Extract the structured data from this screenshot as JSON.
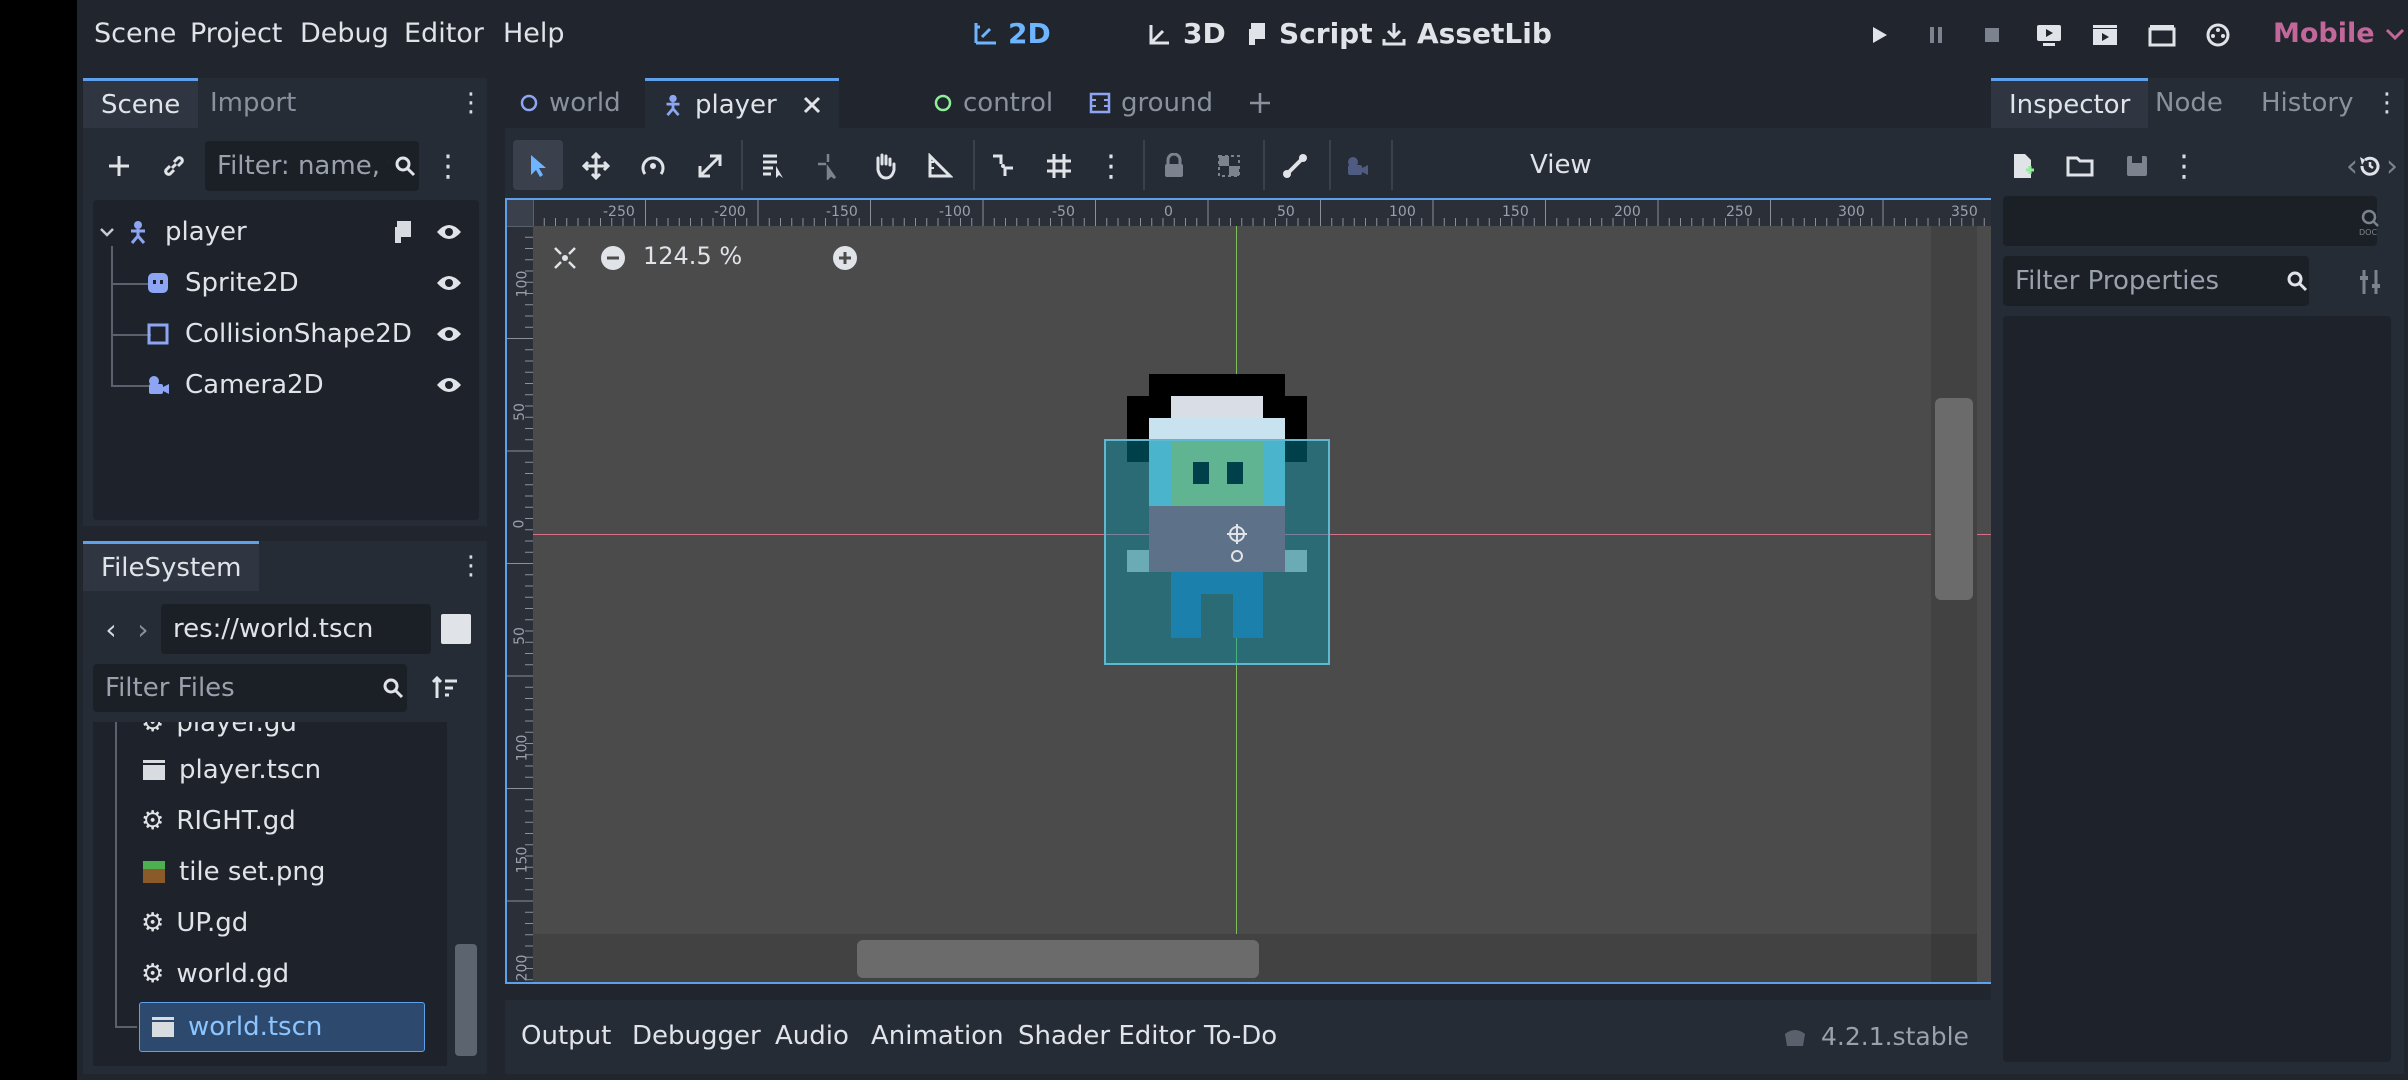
{
  "menubar": {
    "items": [
      "Scene",
      "Project",
      "Debug",
      "Editor",
      "Help"
    ],
    "workspaces": [
      {
        "label": "2D",
        "icon": "2d-icon",
        "active": true
      },
      {
        "label": "3D",
        "icon": "3d-icon",
        "active": false
      },
      {
        "label": "Script",
        "icon": "script-icon",
        "active": false
      },
      {
        "label": "AssetLib",
        "icon": "download-icon",
        "active": false
      }
    ],
    "renderer": "Mobile"
  },
  "scene_dock": {
    "tabs": [
      "Scene",
      "Import"
    ],
    "filter_placeholder": "Filter: name, t:",
    "tree": [
      {
        "name": "player",
        "icon": "character-body-icon",
        "has_script": true
      },
      {
        "name": "Sprite2D",
        "icon": "sprite-icon"
      },
      {
        "name": "CollisionShape2D",
        "icon": "collision-shape-icon"
      },
      {
        "name": "Camera2D",
        "icon": "camera-icon"
      }
    ]
  },
  "filesystem_dock": {
    "tab": "FileSystem",
    "path": "res://world.tscn",
    "filter_placeholder": "Filter Files",
    "files": [
      {
        "name": "player.gd",
        "icon": "gear-icon"
      },
      {
        "name": "player.tscn",
        "icon": "clapper-icon"
      },
      {
        "name": "RIGHT.gd",
        "icon": "gear-icon"
      },
      {
        "name": "tile set.png",
        "icon": "image-icon"
      },
      {
        "name": "UP.gd",
        "icon": "gear-icon"
      },
      {
        "name": "world.gd",
        "icon": "gear-icon"
      },
      {
        "name": "world.tscn",
        "icon": "clapper-icon",
        "selected": true
      }
    ]
  },
  "editor_tabs": [
    {
      "label": "world",
      "icon": "node-icon"
    },
    {
      "label": "player",
      "icon": "character-body-icon",
      "active": true
    },
    {
      "label": "control",
      "icon": "control-icon"
    },
    {
      "label": "ground",
      "icon": "tilemap-icon"
    }
  ],
  "toolbar": {
    "view_label": "View"
  },
  "viewport": {
    "zoom": "124.5 %",
    "ruler_top": [
      "-250",
      "-200",
      "-150",
      "-100",
      "-50",
      "0",
      "50",
      "100",
      "150",
      "200",
      "250",
      "300",
      "350"
    ],
    "ruler_left": [
      "100",
      "50",
      "0",
      "50",
      "100",
      "150",
      "200"
    ]
  },
  "bottom_panel": {
    "tabs": [
      "Output",
      "Debugger",
      "Audio",
      "Animation",
      "Shader Editor",
      "To-Do"
    ],
    "version": "4.2.1.stable"
  },
  "inspector": {
    "tabs": [
      "Inspector",
      "Node",
      "History"
    ],
    "filter_placeholder": "Filter Properties"
  },
  "colors": {
    "accent": "#5fa0ec",
    "renderer": "#c2679a",
    "background": "#21262e"
  }
}
